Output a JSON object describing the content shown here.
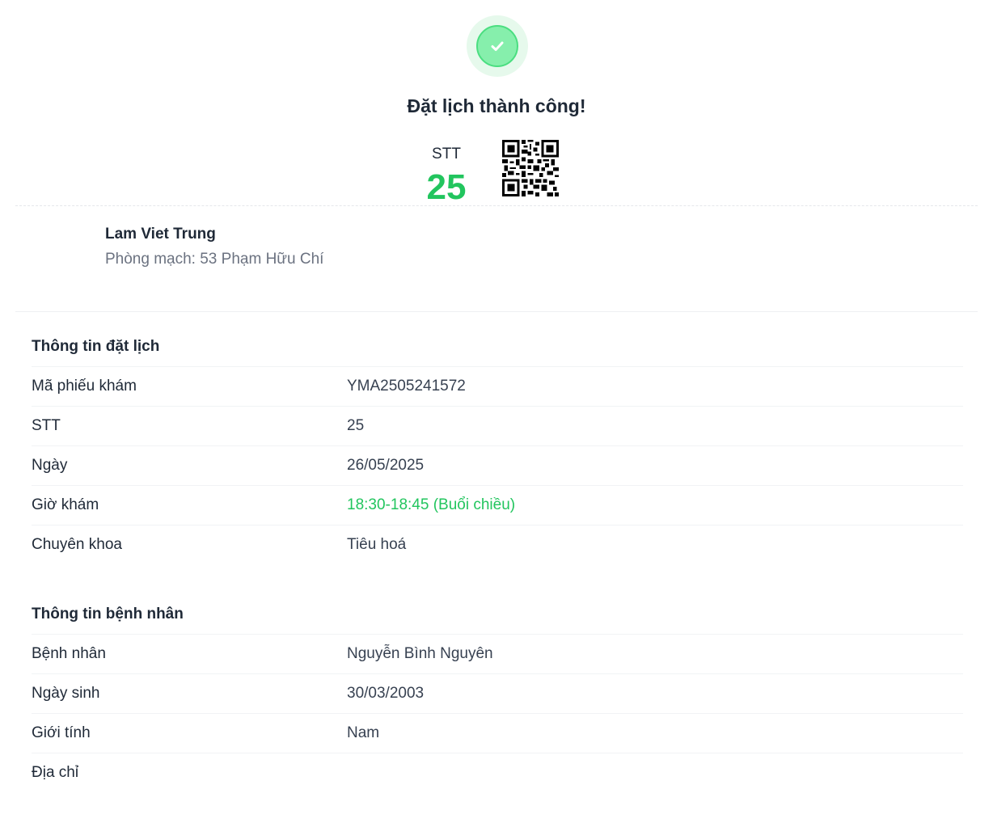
{
  "header": {
    "title": "Đặt lịch thành công!",
    "stt_label": "STT",
    "stt_number": "25",
    "success_icon": "check-circle-icon",
    "qr_icon": "qr-code-icon"
  },
  "doctor": {
    "name": "Lam Viet Trung",
    "clinic": "Phòng mạch: 53 Phạm Hữu Chí"
  },
  "booking_info": {
    "title": "Thông tin đặt lịch",
    "rows": [
      {
        "label": "Mã phiếu khám",
        "value": "YMA2505241572"
      },
      {
        "label": "STT",
        "value": "25"
      },
      {
        "label": "Ngày",
        "value": "26/05/2025"
      },
      {
        "label": "Giờ khám",
        "value": "18:30-18:45 (Buổi chiều)"
      },
      {
        "label": "Chuyên khoa",
        "value": "Tiêu hoá"
      }
    ]
  },
  "patient_info": {
    "title": "Thông tin bệnh nhân",
    "rows": [
      {
        "label": "Bệnh nhân",
        "value": "Nguyễn Bình Nguyên"
      },
      {
        "label": "Ngày sinh",
        "value": "30/03/2003"
      },
      {
        "label": "Giới tính",
        "value": "Nam"
      },
      {
        "label": "Địa chỉ",
        "value": ""
      }
    ]
  },
  "colors": {
    "accent_green": "#22c55e",
    "text_dark": "#1f2937",
    "text_muted": "#6b7280"
  }
}
